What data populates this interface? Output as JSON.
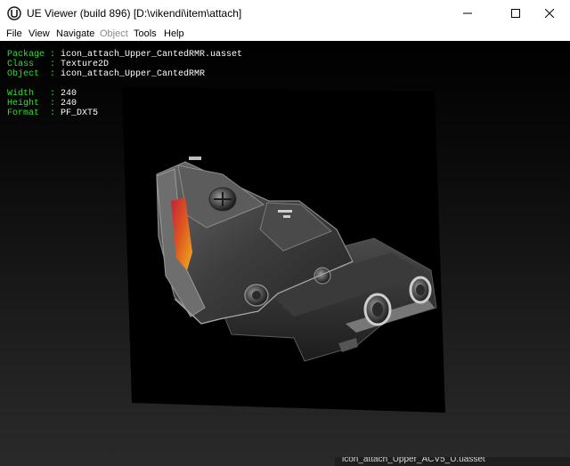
{
  "window": {
    "title": "UE Viewer (build 896) [D:\\vikendi\\item\\attach]"
  },
  "menu": {
    "file": "File",
    "view": "View",
    "navigate": "Navigate",
    "object": "Object",
    "tools": "Tools",
    "help": "Help"
  },
  "info": {
    "package_key": "Package : ",
    "package_val": "icon_attach_Upper_CantedRMR.uasset",
    "class_key": "Class   : ",
    "class_val": "Texture2D",
    "object_key": "Object  : ",
    "object_val": "icon_attach_Upper_CantedRMR",
    "width_key": "Width   : ",
    "width_val": "240",
    "height_key": "Height  : ",
    "height_val": "240",
    "format_key": "Format  : ",
    "format_val": "PF_DXT5"
  },
  "background_window": {
    "title_fragment": "icon_attach_Upper_ACV5_U.uasset"
  },
  "colors": {
    "info_key": "#2ee02e",
    "info_value": "#ffffff",
    "viewport_top": "#000000",
    "viewport_bottom": "#2a2a2a"
  }
}
